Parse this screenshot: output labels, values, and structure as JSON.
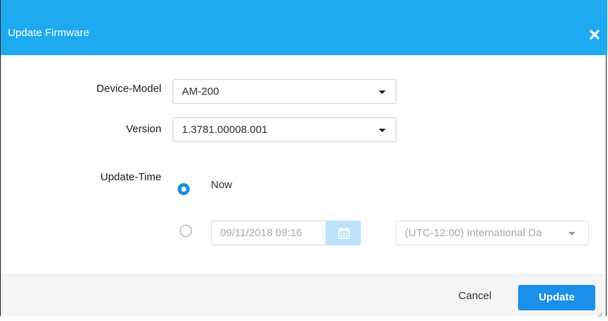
{
  "dialog": {
    "title": "Update Firmware",
    "close_icon": "close-icon"
  },
  "form": {
    "device_model": {
      "label": "Device-Model",
      "value": "AM-200"
    },
    "version": {
      "label": "Version",
      "value": "1.3781.00008.001"
    },
    "update_time": {
      "label": "Update-Time",
      "now_label": "Now",
      "now_selected": true,
      "scheduled_selected": false,
      "date_value": "09/11/2018 09:16",
      "calendar_icon": "calendar-icon",
      "timezone_value": "(UTC-12:00) International Da"
    }
  },
  "footer": {
    "cancel_label": "Cancel",
    "update_label": "Update"
  },
  "colors": {
    "header": "#1eaaf1",
    "primary_button": "#1a90ea",
    "calendar_button": "#bde3fb"
  }
}
